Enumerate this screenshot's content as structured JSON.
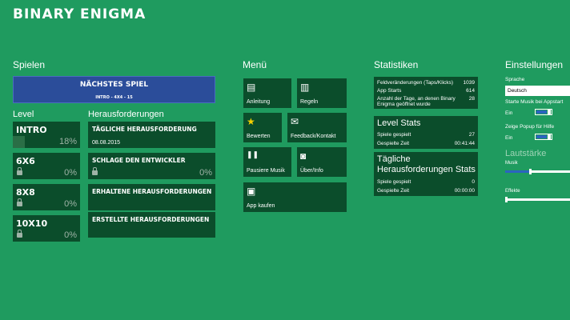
{
  "app": {
    "title": "BINARY ENIGMA"
  },
  "spielen": {
    "header": "Spielen",
    "next_game": {
      "title": "NÄCHSTES SPIEL",
      "subtitle": "INTRO - 4X4 - 15"
    },
    "level_header": "Level",
    "levels": [
      {
        "name": "INTRO",
        "percent": "18%",
        "progress": 0.18,
        "locked": false
      },
      {
        "name": "6X6",
        "percent": "0%",
        "progress": 0,
        "locked": true
      },
      {
        "name": "8X8",
        "percent": "0%",
        "progress": 0,
        "locked": true
      },
      {
        "name": "10X10",
        "percent": "0%",
        "progress": 0,
        "locked": true
      }
    ],
    "challenges_header": "Herausforderungen",
    "challenges": [
      {
        "name": "TÄGLICHE HERAUSFORDERUNG",
        "date": "08.08.2015"
      },
      {
        "name": "SCHLAGE DEN ENTWICKLER",
        "percent": "0%"
      },
      {
        "name": "ERHALTENE HERAUSFORDERUNGEN"
      },
      {
        "name": "ERSTELLTE HERAUSFORDERUNGEN"
      }
    ]
  },
  "menu": {
    "header": "Menü",
    "items": [
      {
        "label": "Anleitung",
        "icon": "clipboard-icon"
      },
      {
        "label": "Regeln",
        "icon": "book-icon"
      },
      {
        "label": "Bewerten",
        "icon": "star-icon"
      },
      {
        "label": "Feedback/Kontakt",
        "icon": "mail-icon"
      },
      {
        "label": "Pausiere Musik",
        "icon": "pause-icon"
      },
      {
        "label": "Über/Info",
        "icon": "stop-circle-icon"
      },
      {
        "label": "App kaufen",
        "icon": "shopping-bag-icon"
      }
    ]
  },
  "stats": {
    "header": "Statistiken",
    "general": [
      {
        "label": "Feldveränderungen (Taps/Klicks)",
        "value": "1039"
      },
      {
        "label": "App Starts",
        "value": "614"
      },
      {
        "label": "Anzahl der Tage, an denen Binary Enigma geöffnet wurde",
        "value": "28"
      }
    ],
    "level_stats": {
      "title": "Level Stats",
      "rows": [
        {
          "label": "Spiele gespielt",
          "value": "27"
        },
        {
          "label": "Gespielte Zeit",
          "value": "00:41:44"
        }
      ]
    },
    "challenge_stats": {
      "title": "Tägliche Herausforderungen Stats",
      "rows": [
        {
          "label": "Spiele gespielt",
          "value": "0"
        },
        {
          "label": "Gespielte Zeit",
          "value": "00:00:00"
        }
      ]
    }
  },
  "settings": {
    "header": "Einstellungen",
    "language_label": "Sprache",
    "language_value": "Deutsch",
    "music_label": "Starte Musik bei Appstart",
    "music_state": "Ein",
    "popup_label": "Zeige Popup für Hilfe",
    "popup_state": "Ein",
    "volume_header": "Lautstärke",
    "music_volume_label": "Musik",
    "music_volume": 0.38,
    "effects_volume_label": "Effekte",
    "effects_volume": 0.0
  }
}
